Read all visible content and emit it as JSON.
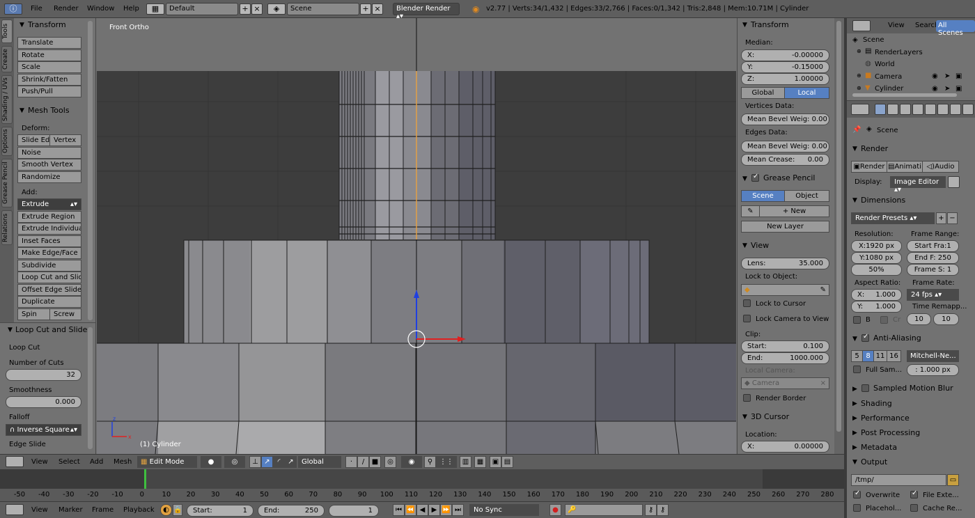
{
  "topbar": {
    "menus": [
      "File",
      "Render",
      "Window",
      "Help"
    ],
    "screen_layout": "Default",
    "scene": "Scene",
    "engine": "Blender Render",
    "stats": "v2.77 | Verts:34/1,432 | Edges:33/2,766 | Faces:0/1,342 | Tris:2,848 | Mem:10.71M | Cylinder"
  },
  "vtabs": [
    "Tools",
    "Create",
    "Shading / UVs",
    "Options",
    "Grease Pencil",
    "Relations"
  ],
  "toolshelf": {
    "transform_title": "Transform",
    "transform_buttons": [
      "Translate",
      "Rotate",
      "Scale",
      "Shrink/Fatten",
      "Push/Pull"
    ],
    "mesh_tools_title": "Mesh Tools",
    "deform_label": "Deform:",
    "slide_edge": "Slide Ed",
    "vertex": "Vertex",
    "noise": "Noise",
    "smooth_vertex": "Smooth Vertex",
    "randomize": "Randomize",
    "add_label": "Add:",
    "extrude": "Extrude",
    "add_buttons": [
      "Extrude Region",
      "Extrude Individual",
      "Inset Faces",
      "Make Edge/Face",
      "Subdivide",
      "Loop Cut and Slide",
      "Offset Edge Slide",
      "Duplicate"
    ],
    "spin": "Spin",
    "screw": "Screw"
  },
  "operator_panel": {
    "title": "Loop Cut and Slide",
    "subtitle": "Loop Cut",
    "cuts_label": "Number of Cuts",
    "cuts_value": "32",
    "smooth_label": "Smoothness",
    "smooth_value": "0.000",
    "falloff_label": "Falloff",
    "falloff_value": "Inverse Square",
    "edge_slide_label": "Edge Slide"
  },
  "viewport": {
    "view_name": "Front Ortho",
    "object_label": "(1) Cylinder"
  },
  "npanel": {
    "transform_title": "Transform",
    "median_label": "Median:",
    "x": "-0.00000",
    "y": "-0.15000",
    "z": "1.00000",
    "x_label": "X:",
    "y_label": "Y:",
    "z_label": "Z:",
    "global": "Global",
    "local": "Local",
    "vertices_data": "Vertices Data:",
    "mean_bevel_v": "Mean Bevel Weig: 0.00",
    "edges_data": "Edges Data:",
    "mean_bevel_e": "Mean Bevel Weig: 0.00",
    "mean_crease_label": "Mean Crease:",
    "mean_crease": "0.00",
    "grease_pencil": "Grease Pencil",
    "gp_scene": "Scene",
    "gp_object": "Object",
    "new": "New",
    "new_layer": "New Layer",
    "view_title": "View",
    "lens_label": "Lens:",
    "lens": "35.000",
    "lock_to_object": "Lock to Object:",
    "lock_to_cursor": "Lock to Cursor",
    "lock_camera": "Lock Camera to View",
    "clip_label": "Clip:",
    "clip_start_label": "Start:",
    "clip_start": "0.100",
    "clip_end_label": "End:",
    "clip_end": "1000.000",
    "local_camera": "Local Camera:",
    "camera": "Camera",
    "render_border": "Render Border",
    "cursor_title": "3D Cursor",
    "location_label": "Location:",
    "cursor_x_label": "X:",
    "cursor_x": "0.00000"
  },
  "outliner": {
    "view": "View",
    "search": "Search",
    "all_scenes": "All Scenes",
    "items": [
      "Scene",
      "RenderLayers",
      "World",
      "Camera",
      "Cylinder"
    ]
  },
  "properties": {
    "scene": "Scene",
    "render_title": "Render",
    "render_btn": "Render",
    "anim_btn": "Animati",
    "audio_btn": "Audio",
    "display_label": "Display:",
    "display_value": "Image Editor",
    "dimensions_title": "Dimensions",
    "render_presets": "Render Presets",
    "resolution_label": "Resolution:",
    "frame_range_label": "Frame Range:",
    "res_x": "X:1920 px",
    "res_y": "Y:1080 px",
    "res_pct": "50%",
    "start_frame": "Start Fra:1",
    "end_frame": "End F: 250",
    "frame_step": "Frame S: 1",
    "aspect_label": "Aspect Ratio:",
    "frame_rate_label": "Frame Rate:",
    "aspect_x_label": "X:",
    "aspect_x": "1.000",
    "aspect_y_label": "Y:",
    "aspect_y": "1.000",
    "fps": "24 fps",
    "time_remap": "Time Remapp...",
    "b_label": "B",
    "cr_label": "Cr",
    "remap_old": "10",
    "remap_new": "10",
    "aa_title": "Anti-Aliasing",
    "aa_samples": [
      "5",
      "8",
      "11",
      "16"
    ],
    "aa_filter": "Mitchell-Ne...",
    "full_sample": "Full Sam...",
    "filter_size": ": 1.000 px",
    "motion_blur": "Sampled Motion Blur",
    "shading": "Shading",
    "performance": "Performance",
    "post_processing": "Post Processing",
    "metadata": "Metadata",
    "output": "Output",
    "output_path": "/tmp/",
    "overwrite": "Overwrite",
    "file_ext": "File Exte...",
    "placeholders": "Placehol...",
    "cache_result": "Cache Re..."
  },
  "view_header": {
    "view": "View",
    "select": "Select",
    "add": "Add",
    "mesh": "Mesh",
    "mode": "Edit Mode",
    "orientation": "Global"
  },
  "timeline": {
    "ticks": [
      "-50",
      "-40",
      "-30",
      "-20",
      "-10",
      "0",
      "10",
      "20",
      "30",
      "40",
      "50",
      "60",
      "70",
      "80",
      "90",
      "100",
      "110",
      "120",
      "130",
      "140",
      "150",
      "160",
      "170",
      "180",
      "190",
      "200",
      "210",
      "220",
      "230",
      "240",
      "250",
      "260",
      "270",
      "280"
    ],
    "current_frame": 0
  },
  "tl_header": {
    "view": "View",
    "marker": "Marker",
    "frame": "Frame",
    "playback": "Playback",
    "start_label": "Start:",
    "start": "1",
    "end_label": "End:",
    "end": "250",
    "current": "1",
    "sync": "No Sync"
  },
  "colors": {
    "accent_blue": "#5680c2",
    "active_frame": "#3fbf3f",
    "header": "#5e5e5e",
    "panel": "#727272"
  }
}
